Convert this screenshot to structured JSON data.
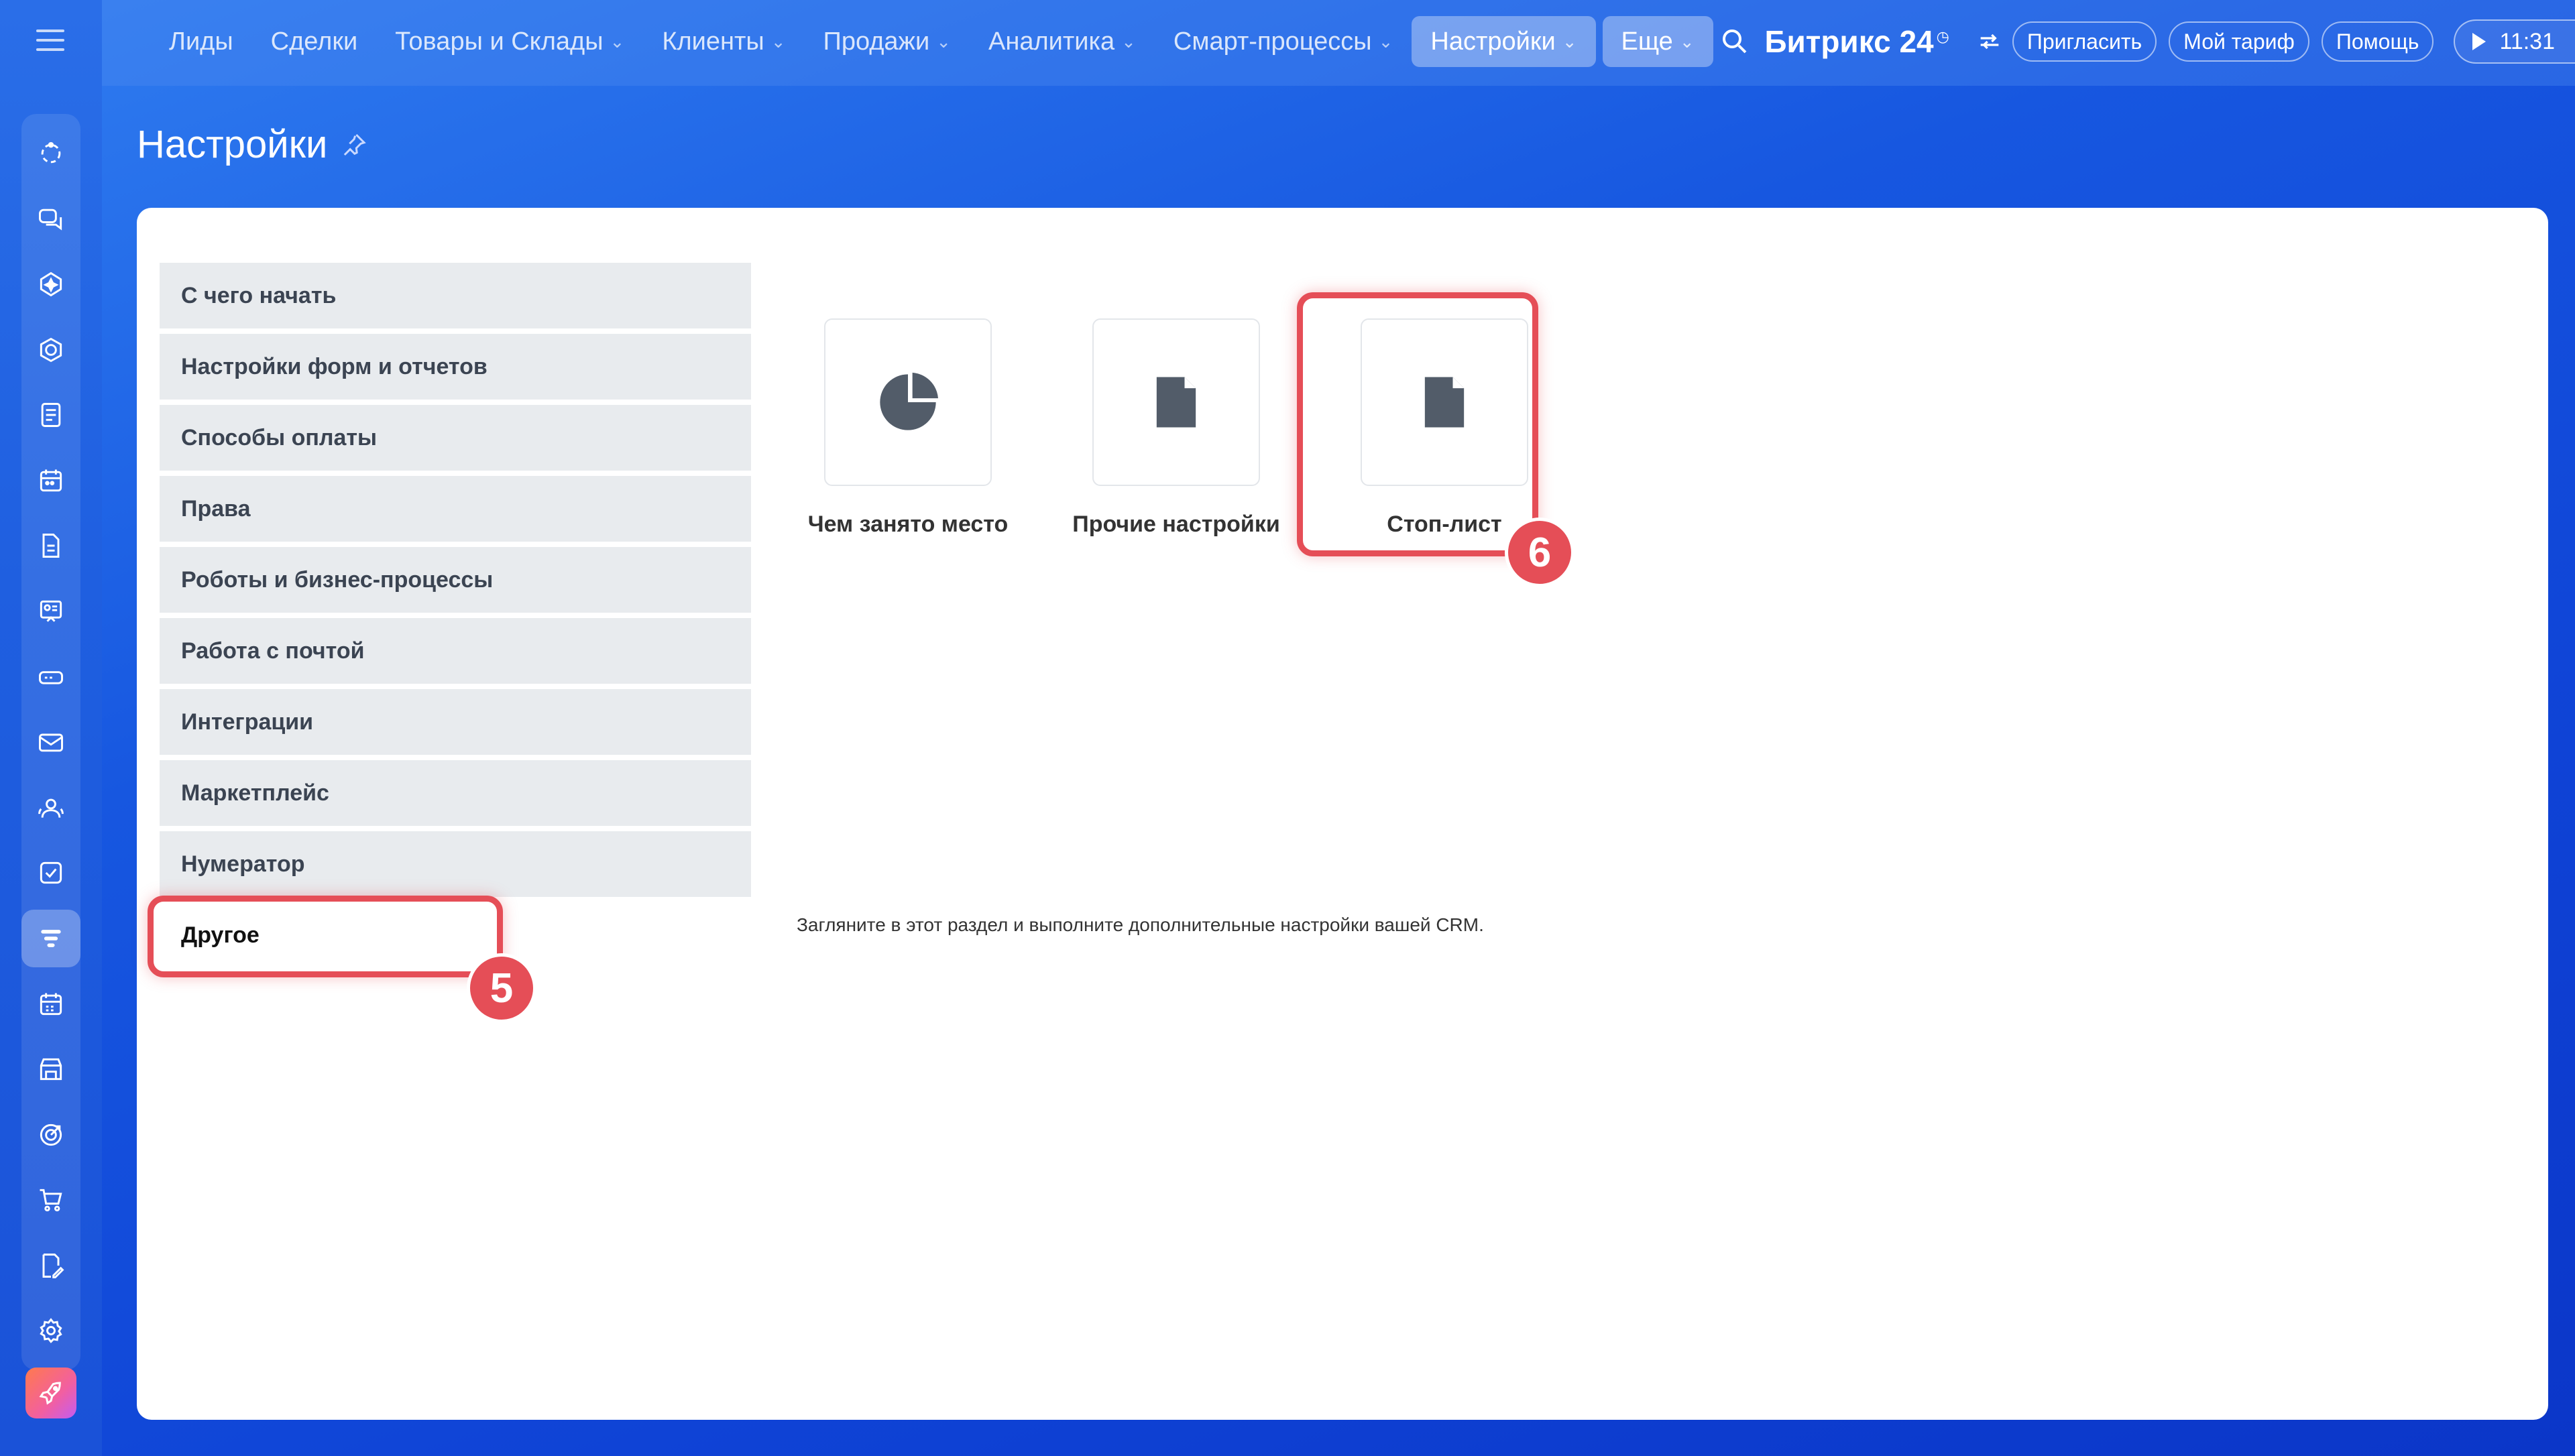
{
  "topnav": {
    "items": [
      {
        "label": "Лиды",
        "has_dropdown": false
      },
      {
        "label": "Сделки",
        "has_dropdown": false
      },
      {
        "label": "Товары и Склады",
        "has_dropdown": true
      },
      {
        "label": "Клиенты",
        "has_dropdown": true
      },
      {
        "label": "Продажи",
        "has_dropdown": true
      },
      {
        "label": "Аналитика",
        "has_dropdown": true
      },
      {
        "label": "Смарт-процессы",
        "has_dropdown": true
      },
      {
        "label": "Настройки",
        "has_dropdown": true,
        "active": true
      }
    ],
    "more_label": "Еще",
    "chevron": "⌄"
  },
  "header": {
    "brand": "Битрикс 24",
    "invite_label": "Пригласить",
    "tariff_label": "Мой тариф",
    "help_label": "Помощь",
    "time": "11:31"
  },
  "page": {
    "title": "Настройки"
  },
  "settings_menu": {
    "items": [
      "С чего начать",
      "Настройки форм и отчетов",
      "Способы оплаты",
      "Права",
      "Роботы и бизнес-процессы",
      "Работа с почтой",
      "Интеграции",
      "Маркетплейс",
      "Нумератор",
      "Другое"
    ],
    "selected": "Другое"
  },
  "tiles": [
    {
      "label": "Чем занято место",
      "icon": "pie-chart-icon"
    },
    {
      "label": "Прочие настройки",
      "icon": "document-icon"
    },
    {
      "label": "Стоп-лист",
      "icon": "document-icon"
    }
  ],
  "description": "Загляните в этот раздел и выполните дополнительные настройки вашей CRM.",
  "annotations": {
    "step5": "5",
    "step6": "6",
    "color": "#e54e57"
  },
  "sidebar": {
    "icons": [
      "feed-icon",
      "chat-icon",
      "copilot-icon",
      "hexagon-icon",
      "news-icon",
      "calendar-icon",
      "document-icon",
      "board-icon",
      "drive-icon",
      "mail-icon",
      "contacts-icon",
      "tasks-icon",
      "crm-icon",
      "booking-icon",
      "store-icon",
      "target-icon",
      "cart-icon",
      "sign-icon",
      "settings-icon"
    ],
    "active": "crm-icon"
  },
  "colors": {
    "accent": "#2f6fe8",
    "callout": "#e54e57"
  }
}
